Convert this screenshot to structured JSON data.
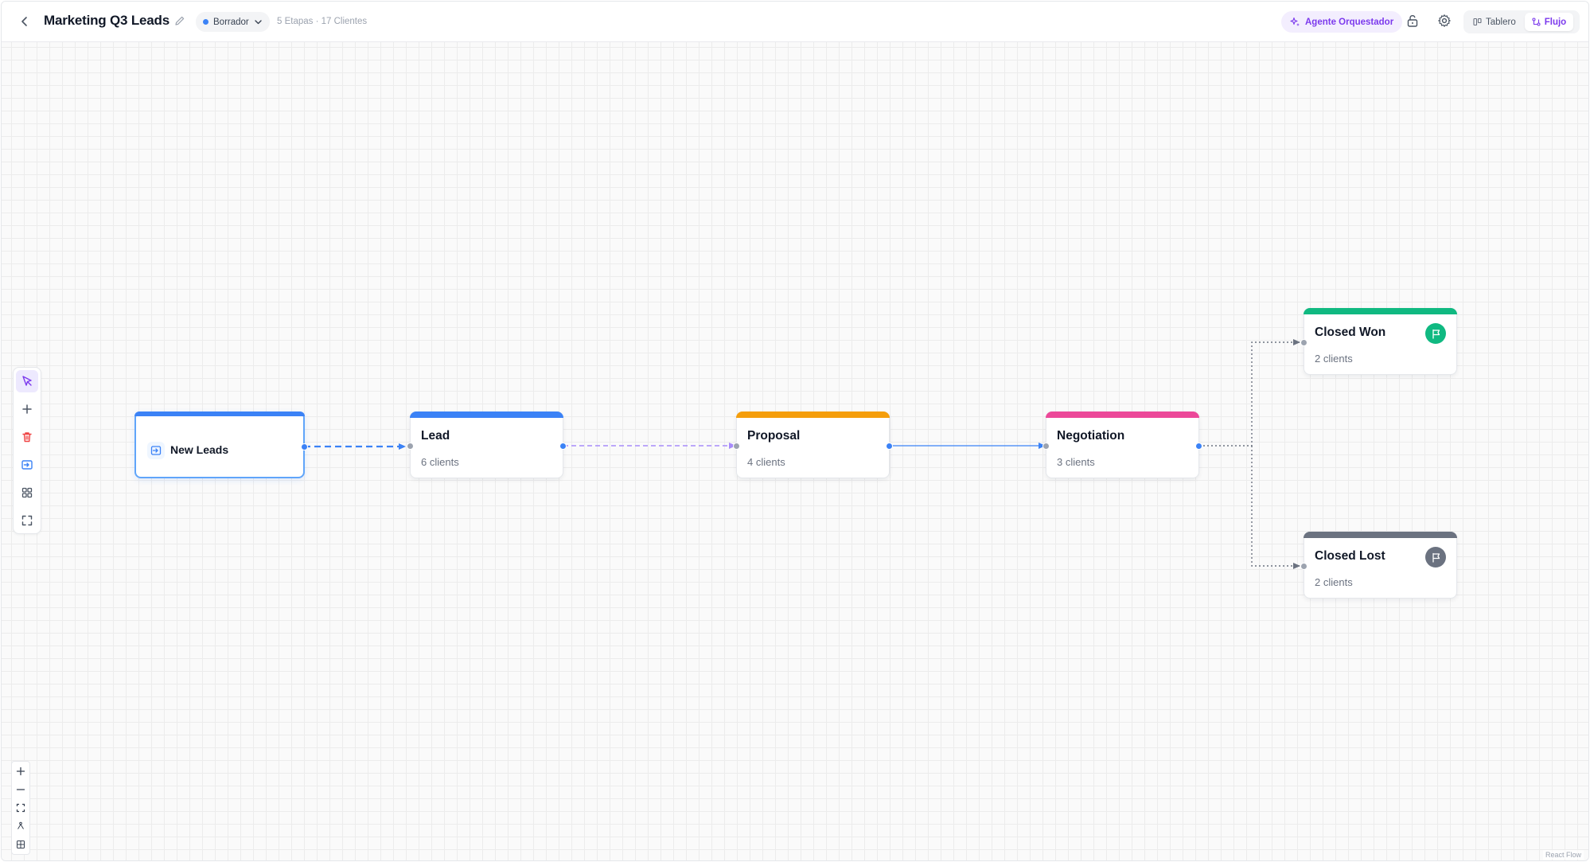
{
  "header": {
    "title": "Marketing Q3 Leads",
    "status": "Borrador",
    "meta": "5 Etapas · 17 Clientes",
    "agent_button": "Agente Orquestador",
    "views": [
      {
        "label": "Tablero",
        "active": false
      },
      {
        "label": "Flujo",
        "active": true
      }
    ]
  },
  "toolbar": {
    "tools": [
      "select-tool",
      "add-tool",
      "delete-tool",
      "trigger-tool",
      "layout-tool",
      "fit-tool"
    ]
  },
  "trigger": {
    "name": "New Leads"
  },
  "stages": [
    {
      "name": "Lead",
      "count": "6 clients",
      "color": "#3b82f6"
    },
    {
      "name": "Proposal",
      "count": "4 clients",
      "color": "#f59e0b"
    },
    {
      "name": "Negotiation",
      "count": "3 clients",
      "color": "#ec4899"
    },
    {
      "name": "Closed Won",
      "count": "2 clients",
      "color": "#10b981"
    },
    {
      "name": "Closed Lost",
      "count": "2 clients",
      "color": "#6b7280"
    }
  ],
  "colors": {
    "accent": "#7c3aed",
    "edge_blue": "#3b82f6",
    "edge_purple": "#a78bfa",
    "edge_gray": "#6b7280"
  },
  "attribution": "React Flow"
}
